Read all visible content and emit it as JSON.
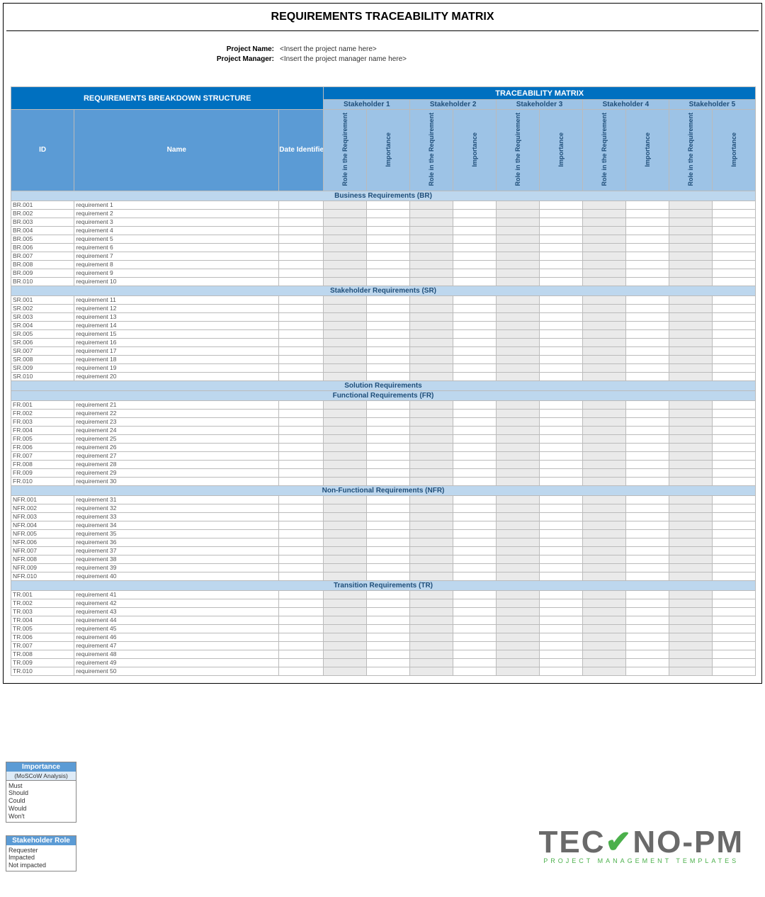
{
  "title": "REQUIREMENTS TRACEABILITY MATRIX",
  "meta": {
    "projectNameLabel": "Project Name:",
    "projectNameVal": "<Insert the project name here>",
    "projectManagerLabel": "Project Manager:",
    "projectManagerVal": "<Insert the project manager name here>"
  },
  "headers": {
    "rbs": "REQUIREMENTS BREAKDOWN STRUCTURE",
    "tm": "TRACEABILITY MATRIX",
    "id": "ID",
    "name": "Name",
    "date": "Date Identified",
    "role": "Role in the Requirement",
    "imp": "Importance",
    "stakeholders": [
      "Stakeholder 1",
      "Stakeholder 2",
      "Stakeholder 3",
      "Stakeholder 4",
      "Stakeholder 5"
    ]
  },
  "sections": [
    {
      "title": "Business Requirements (BR)",
      "prefix": "BR",
      "start": 1
    },
    {
      "title": "Stakeholder Requirements (SR)",
      "prefix": "SR",
      "start": 11
    },
    {
      "title": "Solution Requirements",
      "title2": "Functional Requirements (FR)",
      "prefix": "FR",
      "start": 21
    },
    {
      "title": "Non-Functional Requirements (NFR)",
      "prefix": "NFR",
      "start": 31
    },
    {
      "title": "Transition Requirements (TR)",
      "prefix": "TR",
      "start": 41
    }
  ],
  "rowNamePrefix": "requirement ",
  "legend": {
    "importance": {
      "hdr": "Importance",
      "sub": "(MoSCoW Analysis)",
      "items": [
        "Must",
        "Should",
        "Could",
        "Would",
        "Won't"
      ]
    },
    "role": {
      "hdr": "Stakeholder Role",
      "items": [
        "Requester",
        "Impacted",
        "Not impacted"
      ]
    }
  },
  "logo": {
    "main1": "TEC",
    "main2": "NO-PM",
    "sub": "PROJECT MANAGEMENT TEMPLATES"
  }
}
